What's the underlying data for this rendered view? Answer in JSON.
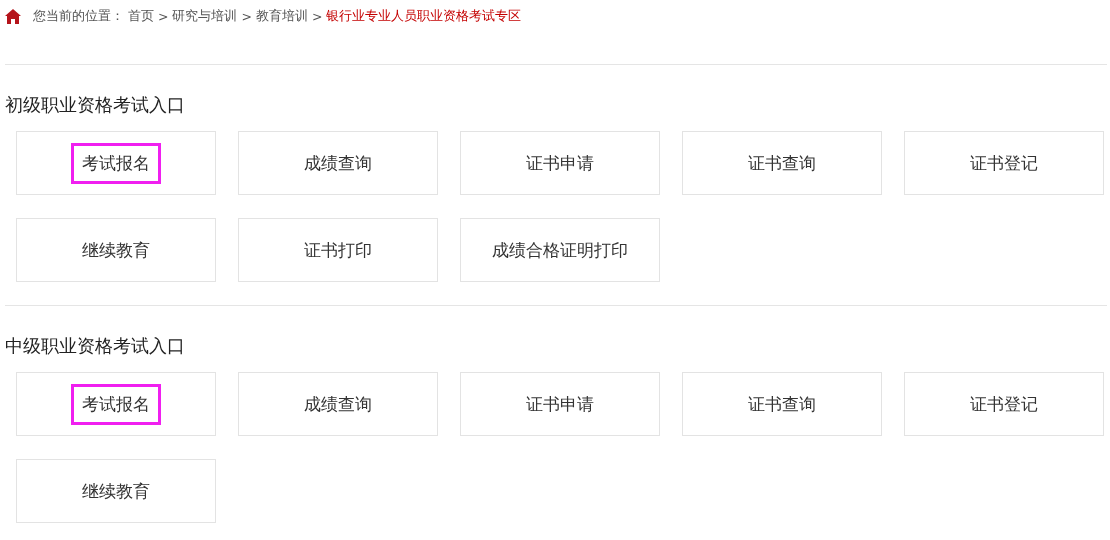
{
  "breadcrumb": {
    "prefix": "您当前的位置：",
    "items": [
      {
        "label": "首页",
        "current": false
      },
      {
        "label": "研究与培训",
        "current": false
      },
      {
        "label": "教育培训",
        "current": false
      },
      {
        "label": "银行业专业人员职业资格考试专区",
        "current": true
      }
    ],
    "separator": ">"
  },
  "sections": [
    {
      "title": "初级职业资格考试入口",
      "entries": [
        {
          "label": "考试报名",
          "highlighted": true
        },
        {
          "label": "成绩查询",
          "highlighted": false
        },
        {
          "label": "证书申请",
          "highlighted": false
        },
        {
          "label": "证书查询",
          "highlighted": false
        },
        {
          "label": "证书登记",
          "highlighted": false
        },
        {
          "label": "继续教育",
          "highlighted": false
        },
        {
          "label": "证书打印",
          "highlighted": false
        },
        {
          "label": "成绩合格证明打印",
          "highlighted": false
        }
      ]
    },
    {
      "title": "中级职业资格考试入口",
      "entries": [
        {
          "label": "考试报名",
          "highlighted": true
        },
        {
          "label": "成绩查询",
          "highlighted": false
        },
        {
          "label": "证书申请",
          "highlighted": false
        },
        {
          "label": "证书查询",
          "highlighted": false
        },
        {
          "label": "证书登记",
          "highlighted": false
        },
        {
          "label": "继续教育",
          "highlighted": false
        }
      ]
    }
  ]
}
